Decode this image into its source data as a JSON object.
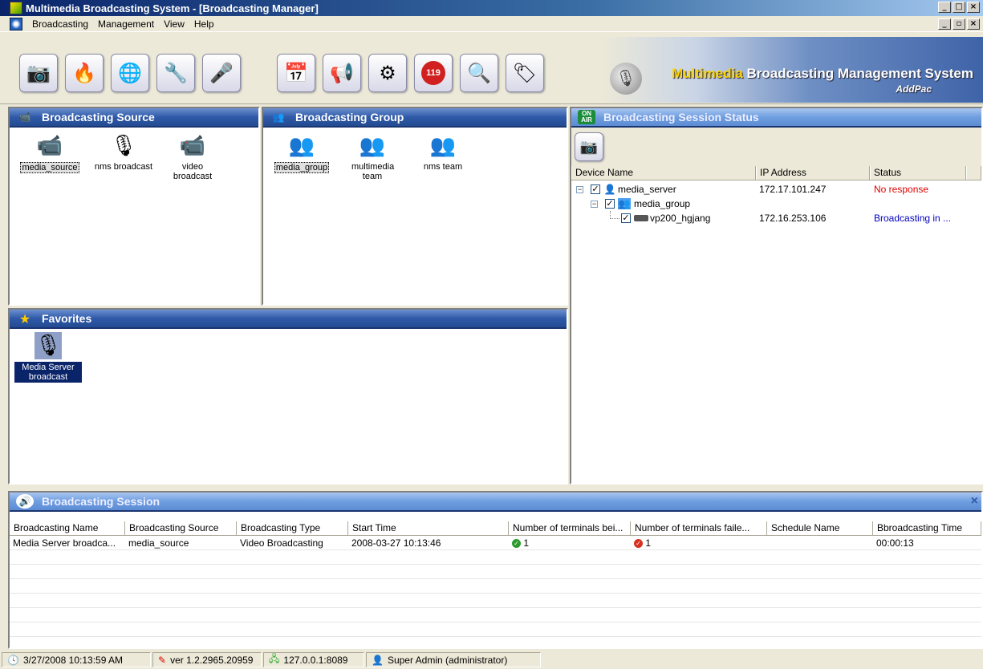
{
  "window": {
    "title": "Multimedia Broadcasting System - [Broadcasting Manager]"
  },
  "menu": {
    "items": [
      "Broadcasting",
      "Management",
      "View",
      "Help"
    ]
  },
  "toolbar": {
    "left_icons": [
      "media-server-icon",
      "emergency-group-icon",
      "network-broadcast-icon",
      "tools-icon",
      "schedule-icon"
    ],
    "right_icons": [
      "calendar-icon",
      "announcer-icon",
      "settings-user-icon",
      "emergency-119-icon",
      "search-document-icon",
      "tag-icon"
    ],
    "emergency_label": "119"
  },
  "brand": {
    "highlight": "Multimedia",
    "rest": " Broadcasting Management System",
    "sub": "AddPac"
  },
  "source_panel": {
    "title": "Broadcasting Source",
    "items": [
      {
        "label": "media_source",
        "icon": "camera-signal-icon"
      },
      {
        "label": "nms broadcast",
        "icon": "microphone-person-icon"
      },
      {
        "label": "video broadcast",
        "icon": "video-camera-icon"
      }
    ]
  },
  "group_panel": {
    "title": "Broadcasting Group",
    "items": [
      {
        "label": "media_group"
      },
      {
        "label": "multimedia team"
      },
      {
        "label": "nms team"
      }
    ]
  },
  "favorites_panel": {
    "title": "Favorites",
    "items": [
      {
        "label": "Media Server broadcast"
      }
    ]
  },
  "status_panel": {
    "title": "Broadcasting Session Status",
    "onair": "ON AIR",
    "columns": [
      "Device Name",
      "IP Address",
      "Status"
    ],
    "rows": [
      {
        "name": "media_server",
        "ip": "172.17.101.247",
        "status": "No response",
        "status_color": "#e00000"
      },
      {
        "name": "media_group",
        "ip": "",
        "status": "",
        "status_color": "#000000"
      },
      {
        "name": "vp200_hgjang",
        "ip": "172.16.253.106",
        "status": "Broadcasting in ...",
        "status_color": "#0000c0"
      }
    ]
  },
  "session_panel": {
    "title": "Broadcasting Session",
    "close": "×",
    "columns": [
      "Broadcasting Name",
      "Broadcasting Source",
      "Broadcasting Type",
      "Start Time",
      "Number of terminals bei...",
      "Number of terminals faile...",
      "Schedule Name",
      "Bbroadcasting Time"
    ],
    "rows": [
      {
        "name": "Media Server broadca...",
        "source": "media_source",
        "type": "Video Broadcasting",
        "start": "2008-03-27 10:13:46",
        "ok": "1",
        "fail": "1",
        "schedule": "",
        "time": "00:00:13"
      }
    ]
  },
  "statusbar": {
    "datetime": "3/27/2008 10:13:59 AM",
    "version": "ver 1.2.2965.20959",
    "address": "127.0.0.1:8089",
    "user": "Super Admin (administrator)"
  },
  "colors": {
    "header_blue": "#2f5aa8",
    "selection": "#0a246a",
    "error": "#e00000",
    "link_blue": "#0000c0",
    "ok_green": "#2c9a2c",
    "fail_red": "#d83020"
  }
}
